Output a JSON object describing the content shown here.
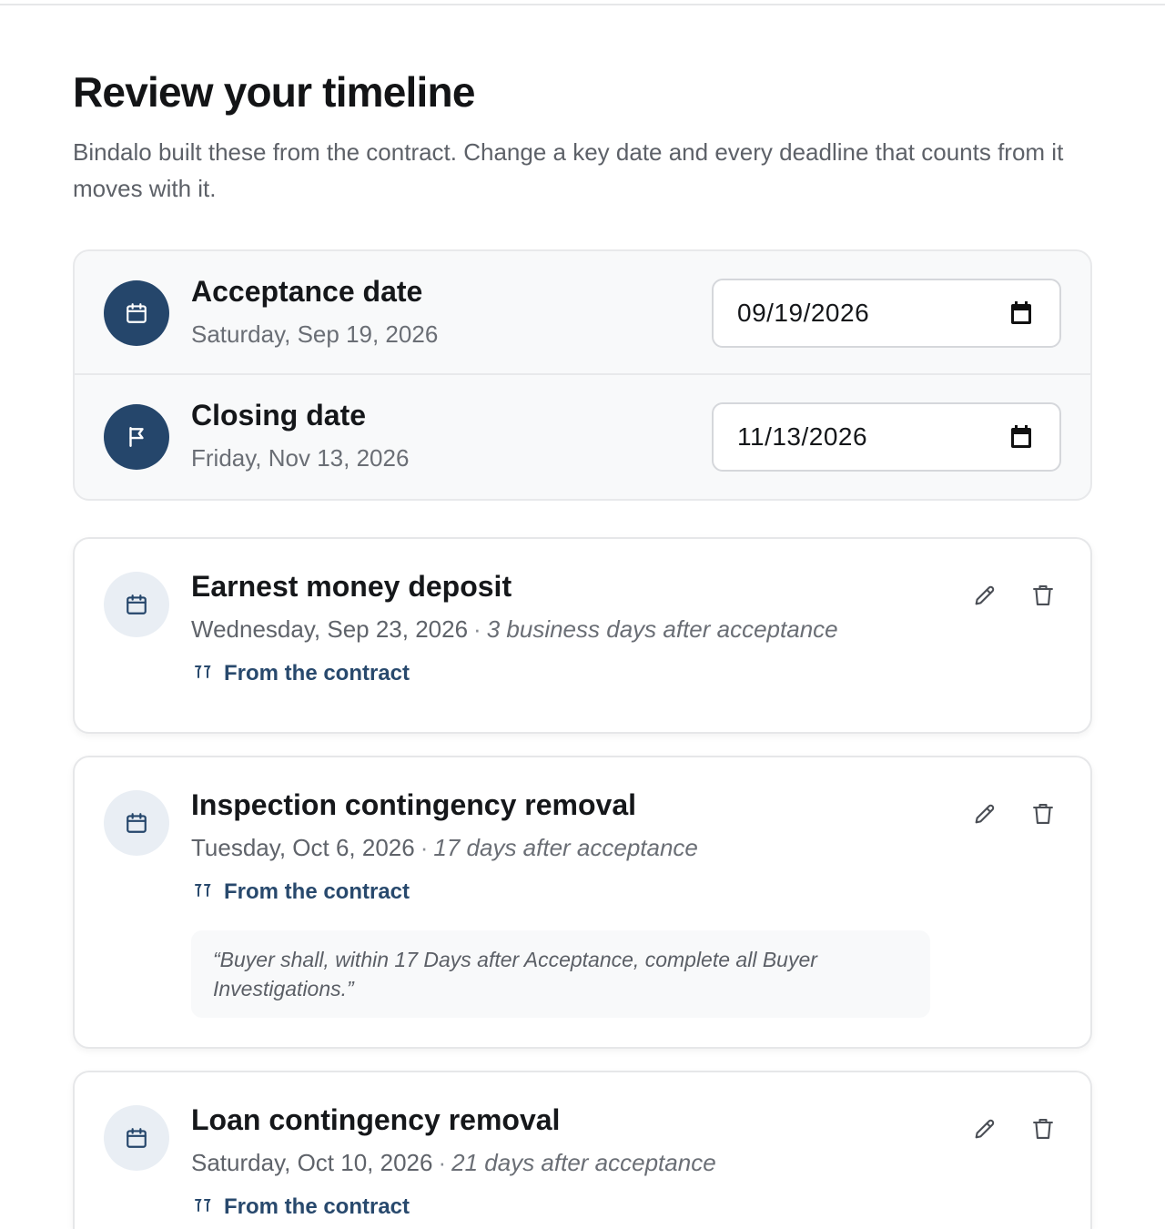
{
  "header": {
    "title": "Review your timeline",
    "subtitle": "Bindalo built these from the contract. Change a key date and every deadline that counts from it moves with it."
  },
  "key_dates": [
    {
      "title": "Acceptance date",
      "day_label": "Saturday, Sep 19, 2026",
      "input_value": "09/19/2026",
      "icon": "calendar-icon"
    },
    {
      "title": "Closing date",
      "day_label": "Friday, Nov 13, 2026",
      "input_value": "11/13/2026",
      "icon": "flag-icon"
    }
  ],
  "deadlines": [
    {
      "title": "Earnest money deposit",
      "date": "Wednesday, Sep 23, 2026",
      "separator": "·",
      "relative": "3 business days after acceptance",
      "source_label": "From the contract"
    },
    {
      "title": "Inspection contingency removal",
      "date": "Tuesday, Oct 6, 2026",
      "separator": "·",
      "relative": "17 days after acceptance",
      "source_label": "From the contract",
      "quote": "“Buyer shall, within 17 Days after Acceptance, complete all Buyer Investigations.”"
    },
    {
      "title": "Loan contingency removal",
      "date": "Saturday, Oct 10, 2026",
      "separator": "·",
      "relative": "21 days after acceptance",
      "source_label": "From the contract"
    }
  ],
  "colors": {
    "accent": "#25466b",
    "link": "#28496d",
    "icon_bg": "#e9eef4",
    "panel_bg": "#f8f9fa"
  }
}
